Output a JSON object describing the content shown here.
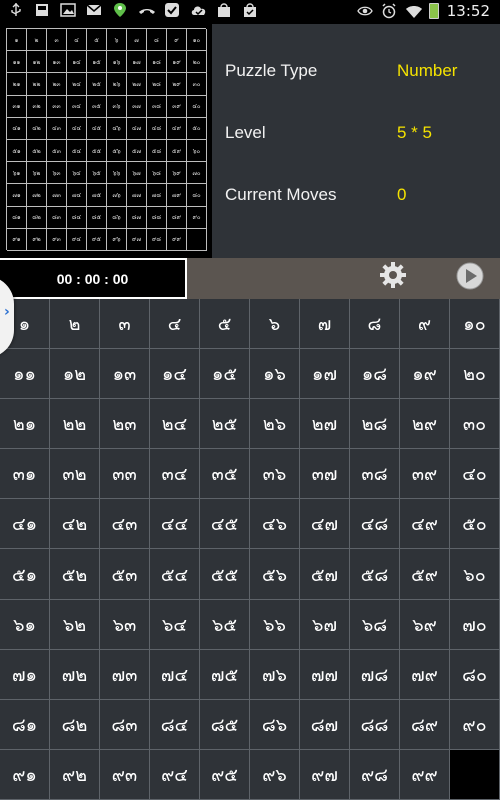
{
  "status_bar": {
    "time": "13:52",
    "left_icons": [
      "usb-icon",
      "sd-card-icon",
      "image-icon",
      "gmail-icon",
      "maps-pin-icon",
      "phone-missed-icon",
      "check-icon",
      "cloud-done-icon",
      "shopping-bag-icon",
      "shopping-bag-check-icon"
    ],
    "right_icons": [
      "eye-icon",
      "alarm-icon",
      "wifi-icon",
      "battery-icon"
    ]
  },
  "info": {
    "puzzle_type_label": "Puzzle Type",
    "puzzle_type_value": "Number",
    "level_label": "Level",
    "level_value": "5 * 5",
    "moves_label": "Current Moves",
    "moves_value": "0"
  },
  "timer": "00 : 00 : 00",
  "colors": {
    "panel": "#2f3338",
    "accent_yellow": "#f5e300",
    "controls_bar": "#5b5550"
  },
  "board": {
    "rows": 10,
    "cols": 10,
    "tiles": [
      "๑",
      "๒",
      "๓",
      "๔",
      "๕",
      "๖",
      "๗",
      "๘",
      "๙",
      "๑๐",
      "๑๑",
      "๑๒",
      "๑๓",
      "๑๔",
      "๑๕",
      "๑๖",
      "๑๗",
      "๑๘",
      "๑๙",
      "๒๐",
      "๒๑",
      "๒๒",
      "๒๓",
      "๒๔",
      "๒๕",
      "๒๖",
      "๒๗",
      "๒๘",
      "๒๙",
      "๓๐",
      "๓๑",
      "๓๒",
      "๓๓",
      "๓๔",
      "๓๕",
      "๓๖",
      "๓๗",
      "๓๘",
      "๓๙",
      "๔๐",
      "๔๑",
      "๔๒",
      "๔๓",
      "๔๔",
      "๔๕",
      "๔๖",
      "๔๗",
      "๔๘",
      "๔๙",
      "๕๐",
      "๕๑",
      "๕๒",
      "๕๓",
      "๕๔",
      "๕๕",
      "๕๖",
      "๕๗",
      "๕๘",
      "๕๙",
      "๖๐",
      "๖๑",
      "๖๒",
      "๖๓",
      "๖๔",
      "๖๕",
      "๖๖",
      "๖๗",
      "๖๘",
      "๖๙",
      "๗๐",
      "๗๑",
      "๗๒",
      "๗๓",
      "๗๔",
      "๗๕",
      "๗๖",
      "๗๗",
      "๗๘",
      "๗๙",
      "๘๐",
      "๘๑",
      "๘๒",
      "๘๓",
      "๘๔",
      "๘๕",
      "๘๖",
      "๘๗",
      "๘๘",
      "๘๙",
      "๙๐",
      "๙๑",
      "๙๒",
      "๙๓",
      "๙๔",
      "๙๕",
      "๙๖",
      "๙๗",
      "๙๘",
      "๙๙",
      ""
    ]
  }
}
